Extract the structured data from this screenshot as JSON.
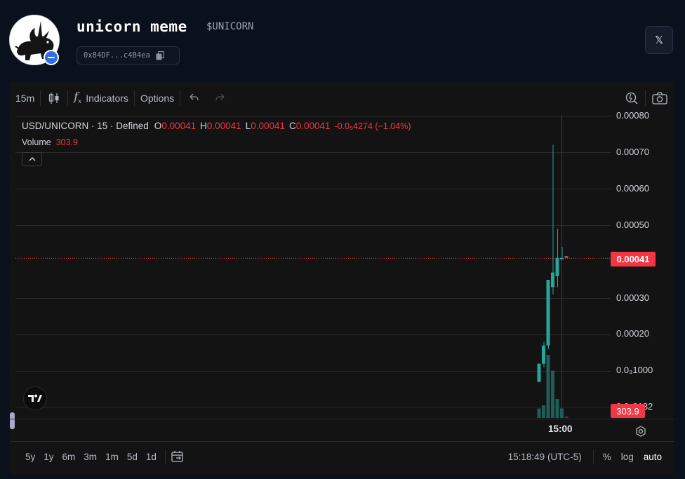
{
  "header": {
    "token_name": "unicorn meme",
    "token_symbol": "$UNICORN",
    "contract_short": "0x84DF...c4B4ea",
    "social_x_label": "𝕏"
  },
  "toolbar": {
    "interval": "15m",
    "indicators_label": "Indicators",
    "options_label": "Options"
  },
  "legend": {
    "pair": "USD/UNICORN",
    "interval": "15",
    "source": "Defined",
    "pair_line": "USD/UNICORN · 15 · Defined",
    "open_label": "O",
    "open_value": "0.00041",
    "high_label": "H",
    "high_value": "0.00041",
    "low_label": "L",
    "low_value": "0.00041",
    "close_label": "C",
    "close_value": "0.00041",
    "change": "-0.0₅4274 (−1.04%)",
    "volume_label": "Volume",
    "volume_value": "303.9"
  },
  "price_axis": {
    "labels": [
      "0.00080",
      "0.00070",
      "0.00060",
      "0.00050",
      "0.00030",
      "0.00020",
      "0.0₃1000",
      "0.0₃8132"
    ],
    "current_price": "0.00041",
    "current_volume": "303.9"
  },
  "time_axis": {
    "labels": [
      "15:00"
    ]
  },
  "bottom_bar": {
    "ranges": [
      "5y",
      "1y",
      "6m",
      "3m",
      "1m",
      "5d",
      "1d"
    ],
    "clock": "15:18:49 (UTC-5)",
    "percent_label": "%",
    "log_label": "log",
    "auto_label": "auto"
  },
  "colors": {
    "up": "#26a69a",
    "down": "#f23645",
    "background": "#131313",
    "page": "#0a101c"
  },
  "chart_data": {
    "type": "candlestick",
    "title": "USD/UNICORN · 15 · Defined",
    "ylim": [
      0,
      0.0008
    ],
    "candles": [
      {
        "open": 7e-05,
        "high": 0.00012,
        "low": 7e-05,
        "close": 0.00012,
        "volume": 30
      },
      {
        "open": 0.00012,
        "high": 0.00018,
        "low": 0.00011,
        "close": 0.00017,
        "volume": 40
      },
      {
        "open": 0.00017,
        "high": 0.00035,
        "low": 0.00016,
        "close": 0.00035,
        "volume": 200
      },
      {
        "open": 0.00033,
        "high": 0.00072,
        "low": 0.00031,
        "close": 0.00037,
        "volume": 150
      },
      {
        "open": 0.00036,
        "high": 0.00049,
        "low": 0.00033,
        "close": 0.00041,
        "volume": 60
      },
      {
        "open": 0.00041,
        "high": 0.00044,
        "low": 0.00041,
        "close": 0.00041,
        "volume": 30
      },
      {
        "open": 0.000415,
        "high": 0.000415,
        "low": 0.00041,
        "close": 0.00041,
        "volume": 5
      }
    ]
  }
}
